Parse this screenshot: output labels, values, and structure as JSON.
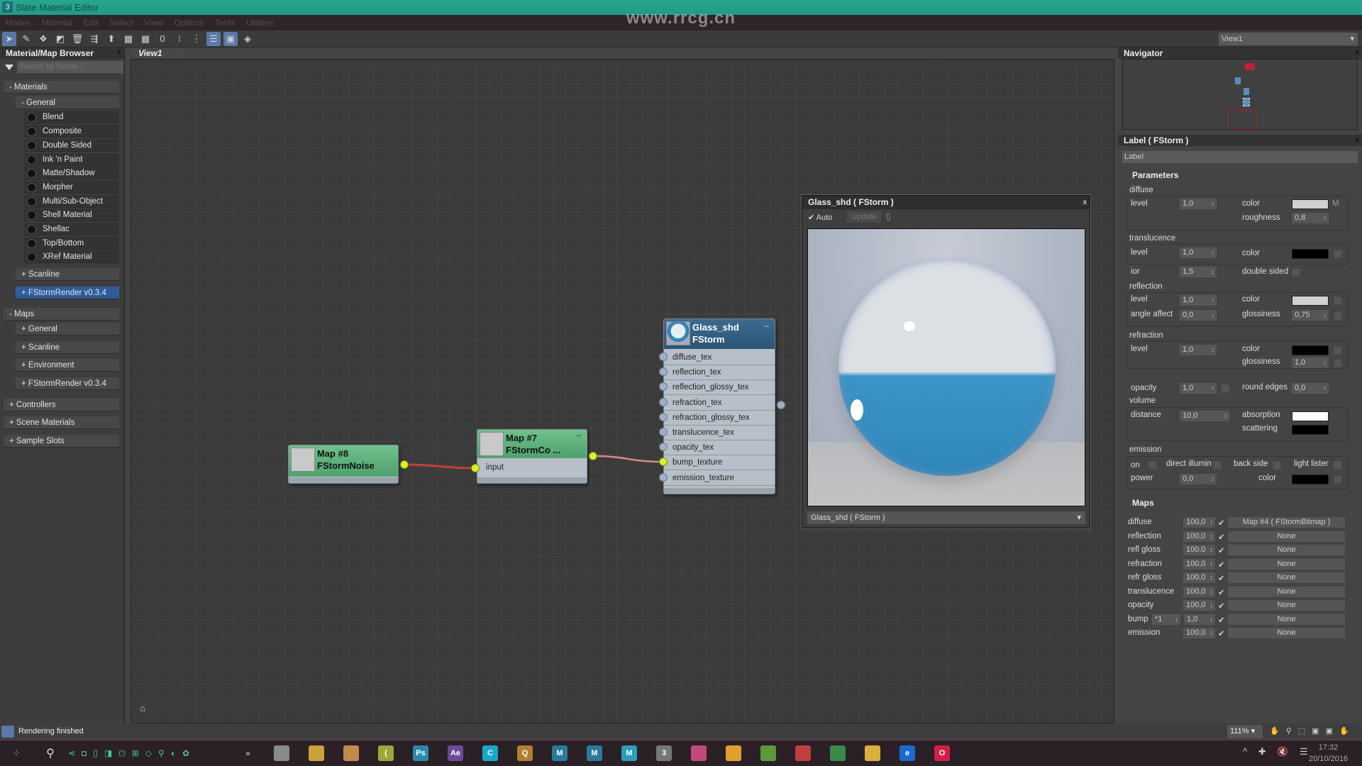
{
  "window": {
    "title": "Slate Material Editor",
    "watermark": "www.rrcg.cn"
  },
  "menu": [
    "Modes",
    "Material",
    "Edit",
    "Select",
    "View",
    "Options",
    "Tools",
    "Utilities"
  ],
  "toolbar": {
    "icons": [
      "select-icon",
      "eyedropper-icon",
      "pick-material-icon",
      "put-to-scene-icon",
      "delete-icon",
      "move-children-icon",
      "assign-material-icon",
      "background-icon",
      "checker-icon",
      "zero-icon",
      "layout-icon",
      "layout-children-icon",
      "parameter-editor-icon",
      "preview-window-icon",
      "render-map-icon"
    ],
    "view_select": "View1"
  },
  "browser": {
    "title": "Material/Map Browser",
    "search_placeholder": "Search by Name ...",
    "items": [
      {
        "label": "- Materials",
        "level": 0
      },
      {
        "label": "- General",
        "level": 1
      },
      {
        "label": "Blend",
        "level": 2
      },
      {
        "label": "Composite",
        "level": 2
      },
      {
        "label": "Double Sided",
        "level": 2
      },
      {
        "label": "Ink 'n Paint",
        "level": 2
      },
      {
        "label": "Matte/Shadow",
        "level": 2
      },
      {
        "label": "Morpher",
        "level": 2
      },
      {
        "label": "Multi/Sub-Object",
        "level": 2
      },
      {
        "label": "Shell Material",
        "level": 2
      },
      {
        "label": "Shellac",
        "level": 2
      },
      {
        "label": "Top/Bottom",
        "level": 2
      },
      {
        "label": "XRef Material",
        "level": 2
      },
      {
        "label": "+ Scanline",
        "level": 1
      },
      {
        "label": "+ FStormRender v0.3.4",
        "level": 1,
        "selected": true
      },
      {
        "label": "- Maps",
        "level": 0
      },
      {
        "label": "+ General",
        "level": 1
      },
      {
        "label": "+ Scanline",
        "level": 1
      },
      {
        "label": "+ Environment",
        "level": 1
      },
      {
        "label": "+ FStormRender v0.3.4",
        "level": 1
      },
      {
        "label": "+ Controllers",
        "level": 0
      },
      {
        "label": "+ Scene Materials",
        "level": 0
      },
      {
        "label": "+ Sample Slots",
        "level": 0
      }
    ]
  },
  "view": {
    "tab": "View1"
  },
  "nodes": {
    "map8": {
      "name": "Map #8",
      "type": "FStormNoise"
    },
    "map7": {
      "name": "Map #7",
      "type": "FStormCo ...",
      "input": "input"
    },
    "glass": {
      "name": "Glass_shd",
      "type": "FStorm",
      "slots": [
        "diffuse_tex",
        "reflection_tex",
        "reflection_glossy_tex",
        "refraction_tex",
        "refraction_glossy_tex",
        "translucence_tex",
        "opacity_tex",
        "bump_texture",
        "emission_texture"
      ],
      "connected_slot": "bump_texture"
    }
  },
  "preview": {
    "title": "Glass_shd  ( FStorm )",
    "auto": "Auto",
    "auto_checked": true,
    "update": "Update",
    "footer": "Glass_shd  ( FStorm )"
  },
  "navigator": {
    "title": "Navigator"
  },
  "params": {
    "title": "Label  ( FStorm )",
    "label_field": "Label",
    "section": "Parameters",
    "diffuse": {
      "group": "diffuse",
      "level_label": "level",
      "level": "1,0",
      "color_label": "color",
      "color": "#d0d0d0",
      "m": "M",
      "roughness_label": "roughness",
      "roughness": "0,8"
    },
    "translucence": {
      "group": "translucence",
      "level_label": "level",
      "level": "1,0",
      "color_label": "color",
      "color": "#000000"
    },
    "ior_label": "ior",
    "ior": "1,5",
    "double_sided": "double sided",
    "reflection": {
      "group": "reflection",
      "level_label": "level",
      "level": "1,0",
      "color_label": "color",
      "color": "#d0d0d0",
      "angle_label": "angle affect",
      "angle": "0,0",
      "gloss_label": "glossiness",
      "gloss": "0,75"
    },
    "refraction": {
      "group": "refraction",
      "level_label": "level",
      "level": "1,0",
      "color_label": "color",
      "color": "#000000",
      "gloss_label": "glossiness",
      "gloss": "1,0"
    },
    "opacity_label": "opacity",
    "opacity": "1,0",
    "round_label": "round edges",
    "round": "0,0",
    "volume": {
      "group": "volume",
      "distance_label": "distance",
      "distance": "10,0",
      "absorption_label": "absorption",
      "absorption": "#ffffff",
      "scattering_label": "scattering",
      "scattering": "#000000"
    },
    "emission": {
      "group": "emission",
      "on": "on",
      "direct": "direct illumin",
      "back": "back side",
      "lister": "light lister",
      "power_label": "power",
      "power": "0,0",
      "color_label": "color",
      "color": "#000000"
    }
  },
  "maps": {
    "section": "Maps",
    "bump_mult": "*1",
    "rows": [
      {
        "label": "diffuse",
        "amount": "100,0",
        "map": "Map #4  ( FStormBitmap )"
      },
      {
        "label": "reflection",
        "amount": "100,0",
        "map": "None"
      },
      {
        "label": "refl gloss",
        "amount": "100,0",
        "map": "None"
      },
      {
        "label": "refraction",
        "amount": "100,0",
        "map": "None"
      },
      {
        "label": "refr gloss",
        "amount": "100,0",
        "map": "None"
      },
      {
        "label": "translucence",
        "amount": "100,0",
        "map": "None"
      },
      {
        "label": "opacity",
        "amount": "100,0",
        "map": "None"
      },
      {
        "label": "bump",
        "amount": "1,0",
        "map": "None"
      },
      {
        "label": "emission",
        "amount": "100,0",
        "map": "None"
      }
    ]
  },
  "status": {
    "text": "Rendering finished",
    "zoom": "111%"
  },
  "taskbar": {
    "apps": [
      {
        "n": "explorer-save-icon",
        "c": "#8a8a8a",
        "t": ""
      },
      {
        "n": "chrome-icon",
        "c": "#c9a23a",
        "t": ""
      },
      {
        "n": "file-icon",
        "c": "#c08a4a",
        "t": ""
      },
      {
        "n": "app-icon",
        "c": "#9aa83a",
        "t": "("
      },
      {
        "n": "photoshop-icon",
        "c": "#2a8aa8",
        "t": "Ps"
      },
      {
        "n": "after-effects-icon",
        "c": "#6a4a9a",
        "t": "Ae"
      },
      {
        "n": "app-icon",
        "c": "#1aa8c8",
        "t": "C"
      },
      {
        "n": "app-icon",
        "c": "#b08030",
        "t": "Q"
      },
      {
        "n": "maya-icon",
        "c": "#2a7a9a",
        "t": "M"
      },
      {
        "n": "maya-icon",
        "c": "#2a7a9a",
        "t": "M"
      },
      {
        "n": "app-icon",
        "c": "#2aa0b8",
        "t": "M"
      },
      {
        "n": "3dsmax-icon",
        "c": "#777",
        "t": "3"
      },
      {
        "n": "app-icon",
        "c": "#c04a7a",
        "t": ""
      },
      {
        "n": "blender-icon",
        "c": "#e0a030",
        "t": ""
      },
      {
        "n": "evernote-icon",
        "c": "#5a9a3a",
        "t": ""
      },
      {
        "n": "app-icon",
        "c": "#c04040",
        "t": ""
      },
      {
        "n": "spotify-icon",
        "c": "#3a8a4a",
        "t": ""
      },
      {
        "n": "folder-icon",
        "c": "#d8b040",
        "t": ""
      },
      {
        "n": "edge-icon",
        "c": "#1a6ad0",
        "t": "e"
      },
      {
        "n": "opera-icon",
        "c": "#d0204a",
        "t": "O"
      }
    ],
    "time": "17:32",
    "date": "20/10/2016"
  },
  "colors": {
    "accent": "#2f5c99",
    "node_green": "#5fb47e",
    "wire": "#c83c3c",
    "socket_active": "#d6f22a",
    "titlebar": "#22a08a"
  }
}
